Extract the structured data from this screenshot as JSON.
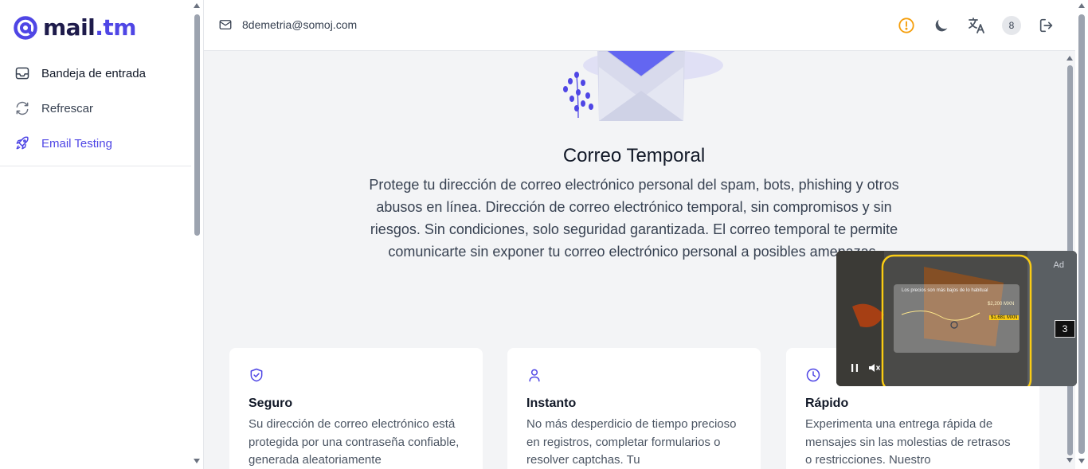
{
  "app": {
    "logo_prefix": "mail",
    "logo_suffix": ".tm",
    "brand_color": "#4f46e5"
  },
  "sidebar": {
    "items": [
      {
        "label": "Bandeja de entrada",
        "icon": "inbox-icon"
      },
      {
        "label": "Refrescar",
        "icon": "refresh-icon"
      },
      {
        "label": "Email Testing",
        "icon": "rocket-icon"
      }
    ]
  },
  "topbar": {
    "email": "8demetria@somoj.com",
    "icons": [
      "warning-icon",
      "moon-icon",
      "translate-icon",
      "badge-count",
      "logout-icon"
    ],
    "badge_count": "8",
    "warning_color": "#f59e0b"
  },
  "hero": {
    "title": "Correo Temporal",
    "description": "Protege tu dirección de correo electrónico personal del spam, bots, phishing y otros abusos en línea. Dirección de correo electrónico temporal, sin compromisos y sin riesgos. Sin condiciones, solo seguridad garantizada. El correo temporal te permite comunicarte sin exponer tu correo electrónico personal a posibles amenazas."
  },
  "features": [
    {
      "icon": "shield-check-icon",
      "title": "Seguro",
      "text": "Su dirección de correo electrónico está protegida por una contraseña confiable, generada aleatoriamente"
    },
    {
      "icon": "user-icon",
      "title": "Instanto",
      "text": "No más desperdicio de tiempo precioso en registros, completar formularios o resolver captchas. Tu"
    },
    {
      "icon": "clock-icon",
      "title": "Rápido",
      "text": "Experimenta una entrega rápida de mensajes sin las molestias de retrasos o restricciones. Nuestro"
    }
  ],
  "ad": {
    "label": "Ad",
    "counter": "3",
    "headline": "Los precios son más bajos de lo habitual",
    "price_1": "$2,200 MXN",
    "price_2": "$1,681 MXN"
  }
}
